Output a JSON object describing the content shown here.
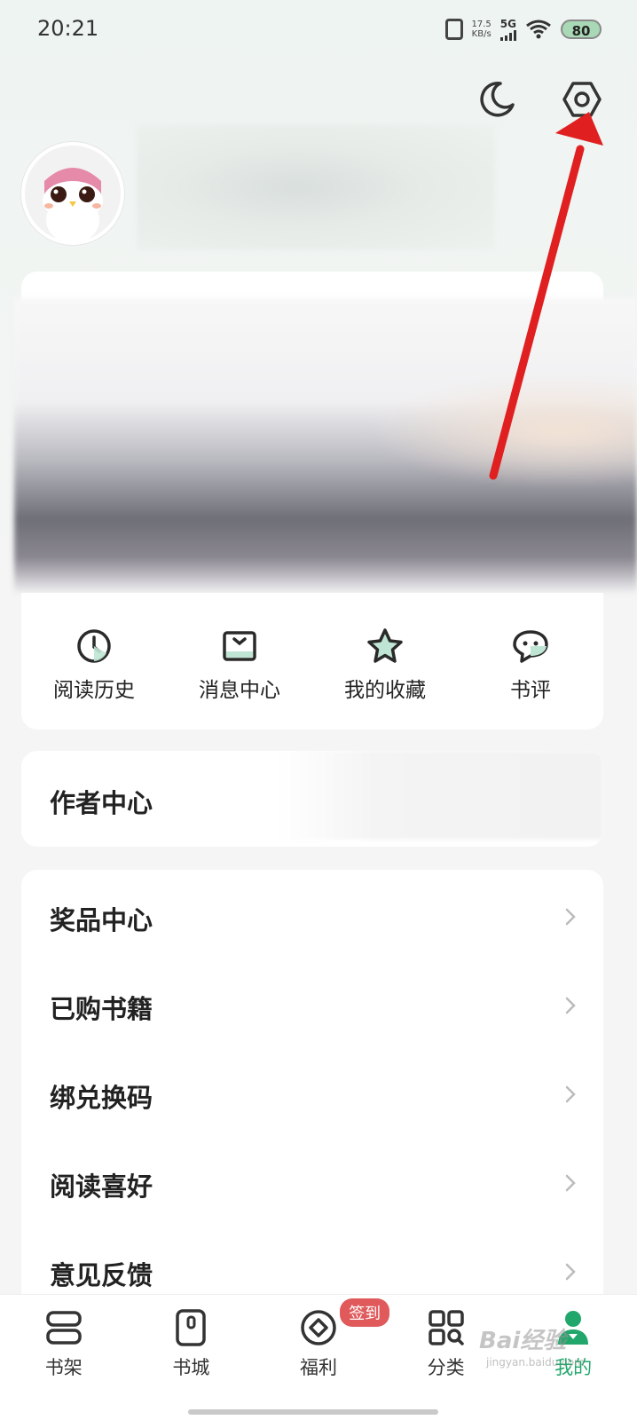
{
  "status_bar": {
    "time": "20:21",
    "net_speed_value": "17.5",
    "net_speed_unit": "KB/s",
    "network": "5G",
    "battery": "80"
  },
  "header": {
    "night_mode_icon": "moon-icon",
    "settings_icon": "gear-icon"
  },
  "quick_actions": [
    {
      "label": "阅读历史",
      "icon": "clock-icon"
    },
    {
      "label": "消息中心",
      "icon": "mail-icon"
    },
    {
      "label": "我的收藏",
      "icon": "star-icon"
    },
    {
      "label": "书评",
      "icon": "chat-bubble-icon"
    }
  ],
  "author_center": {
    "label": "作者中心"
  },
  "menu": [
    {
      "label": "奖品中心"
    },
    {
      "label": "已购书籍"
    },
    {
      "label": "绑兑换码"
    },
    {
      "label": "阅读喜好"
    },
    {
      "label": "意见反馈"
    }
  ],
  "tabs": [
    {
      "label": "书架",
      "icon": "bookshelf-icon",
      "active": false
    },
    {
      "label": "书城",
      "icon": "bookstore-icon",
      "active": false
    },
    {
      "label": "福利",
      "icon": "welfare-coin-icon",
      "active": false,
      "badge": "签到"
    },
    {
      "label": "分类",
      "icon": "category-grid-icon",
      "active": false
    },
    {
      "label": "我的",
      "icon": "profile-icon",
      "active": true
    }
  ],
  "colors": {
    "accent": "#21a66b",
    "badge": "#e05a5c",
    "annotation_arrow": "#e02020"
  },
  "watermark": {
    "text": "Bai经验",
    "sub": "jingyan.baidu.com"
  }
}
